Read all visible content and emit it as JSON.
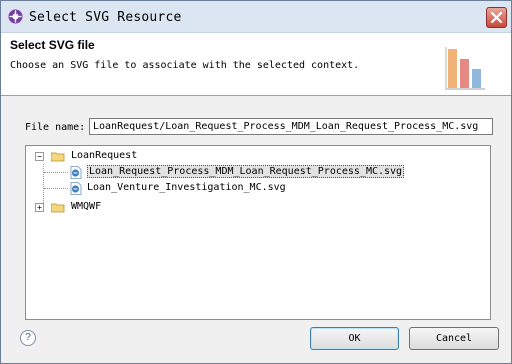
{
  "window": {
    "title": "Select SVG Resource"
  },
  "banner": {
    "title": "Select SVG file",
    "description": "Choose an SVG file to associate with the selected context.",
    "icon": "bar-chart-icon"
  },
  "form": {
    "file_name_label": "File name:",
    "file_name_value": "LoanRequest/Loan_Request_Process_MDM_Loan_Request_Process_MC.svg"
  },
  "tree": {
    "items": [
      {
        "label": "LoanRequest",
        "expander": "−"
      },
      {
        "label": "Loan_Request_Process_MDM_Loan_Request_Process_MC.svg"
      },
      {
        "label": "Loan_Venture_Investigation_MC.svg"
      },
      {
        "label": "WMQWF",
        "expander": "+"
      }
    ]
  },
  "footer": {
    "help_label": "?",
    "ok_label": "OK",
    "cancel_label": "Cancel"
  }
}
